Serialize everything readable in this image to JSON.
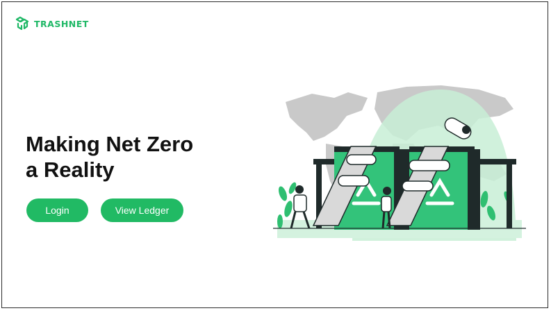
{
  "brand": {
    "name": "TRASHNET",
    "logo_icon": "recycle-cube-icon",
    "color": "#1fb866"
  },
  "hero": {
    "headline_line1": "Making Net Zero",
    "headline_line2": "a Reality"
  },
  "actions": {
    "login_label": "Login",
    "ledger_label": "View Ledger",
    "button_color": "#21ba64"
  },
  "illustration": {
    "subject": "recycling-conveyor-illustration"
  }
}
